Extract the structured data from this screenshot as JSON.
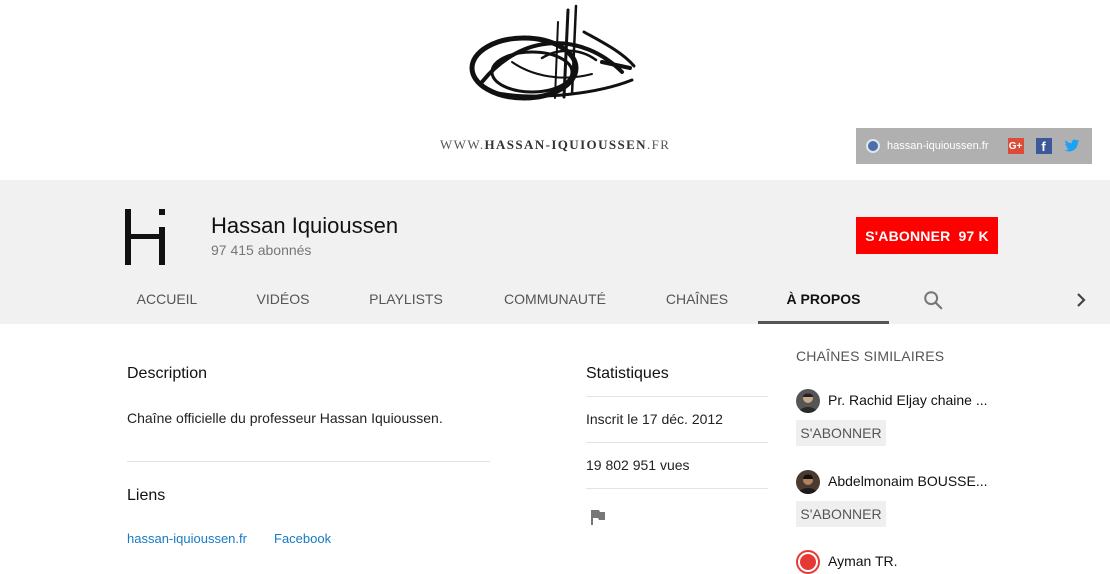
{
  "banner": {
    "url_prefix": "WWW.",
    "url_main": "HASSAN-IQUIOUSSEN",
    "url_suffix": ".FR",
    "links": {
      "site_label": "hassan-iquioussen.fr",
      "gplus_icon": "google-plus-icon",
      "facebook_icon": "facebook-icon",
      "twitter_icon": "twitter-icon"
    }
  },
  "channel": {
    "name": "Hassan Iquioussen",
    "subscribers": "97 415 abonnés",
    "subscribe_label": "S'ABONNER",
    "subscribe_count": "97 K"
  },
  "tabs": [
    {
      "label": "ACCUEIL"
    },
    {
      "label": "VIDÉOS"
    },
    {
      "label": "PLAYLISTS"
    },
    {
      "label": "COMMUNAUTÉ"
    },
    {
      "label": "CHAÎNES"
    },
    {
      "label": "À PROPOS",
      "active": true
    }
  ],
  "about": {
    "description_heading": "Description",
    "description_text": "Chaîne officielle du professeur Hassan Iquioussen.",
    "links_heading": "Liens",
    "links": [
      "hassan-iquioussen.fr",
      "Facebook"
    ]
  },
  "stats": {
    "heading": "Statistiques",
    "joined": "Inscrit le 17 déc. 2012",
    "views": "19 802 951 vues"
  },
  "related": {
    "title": "CHAÎNES SIMILAIRES",
    "channels": [
      {
        "name": "Pr. Rachid Eljay chaine ...",
        "subscribe_label": "S'ABONNER"
      },
      {
        "name": "Abdelmonaim BOUSSE...",
        "subscribe_label": "S'ABONNER"
      },
      {
        "name": "Ayman TR."
      }
    ]
  },
  "colors": {
    "accent": "#ff0000",
    "link": "#167ac6",
    "header_bg": "#f1f1f1"
  }
}
